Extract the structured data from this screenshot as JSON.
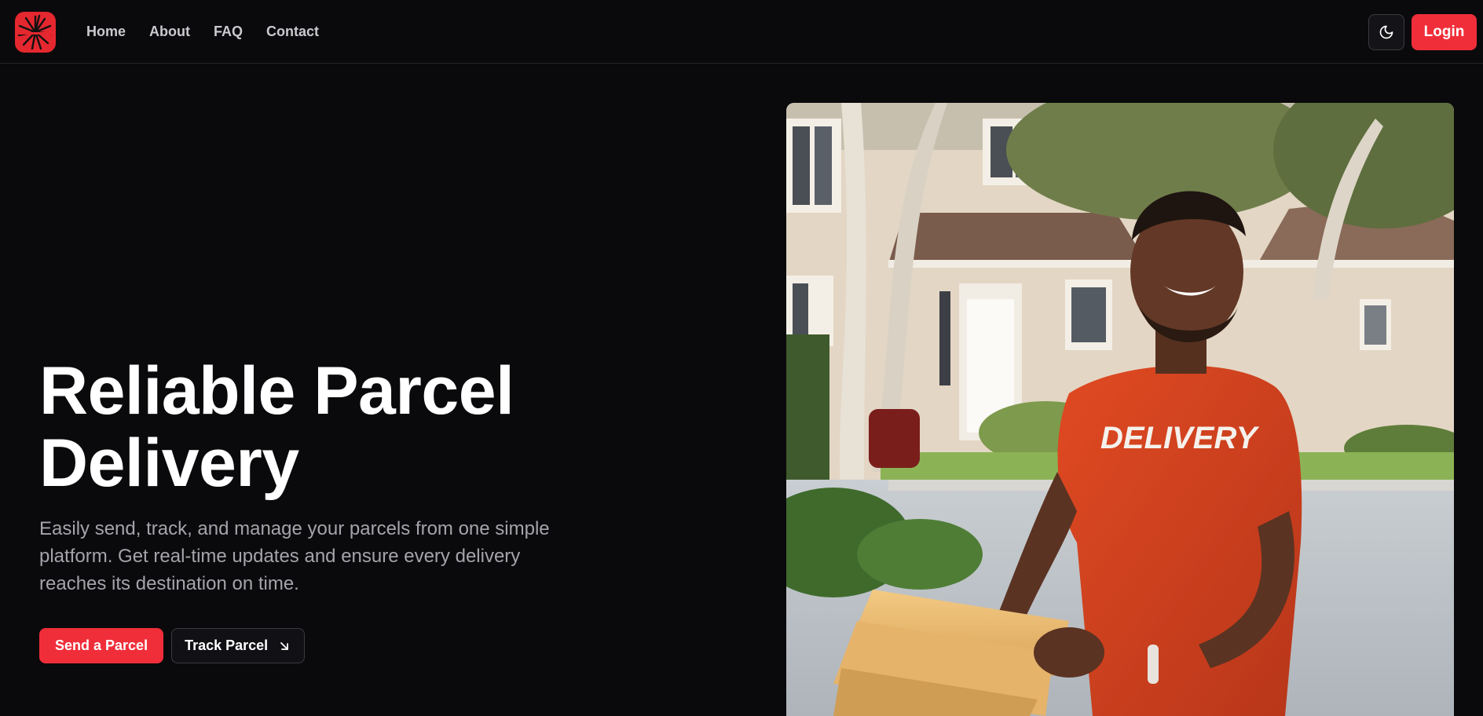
{
  "nav": {
    "logo_icon": "starburst-logo-icon",
    "links": [
      {
        "label": "Home"
      },
      {
        "label": "About"
      },
      {
        "label": "FAQ"
      },
      {
        "label": "Contact"
      }
    ],
    "theme_toggle_icon": "moon-icon",
    "login_label": "Login"
  },
  "hero": {
    "title_line1": "Reliable Parcel",
    "title_line2": "Delivery",
    "description": "Easily send, track, and manage your parcels from one simple platform. Get real-time updates and ensure every delivery reaches its destination on time.",
    "primary_button": "Send a Parcel",
    "secondary_button": "Track Parcel",
    "secondary_icon": "arrow-down-right-icon",
    "image_shirt_text": "DELIVERY"
  },
  "colors": {
    "background": "#0a0a0c",
    "accent": "#f02e3a",
    "muted_text": "#a4a4ab"
  }
}
